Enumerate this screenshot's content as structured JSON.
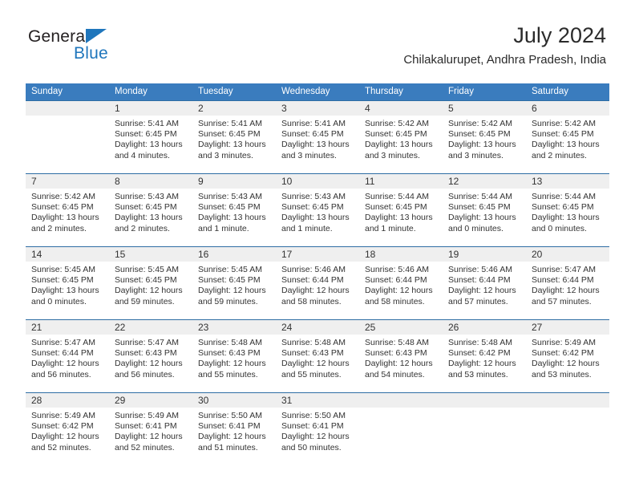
{
  "brand": {
    "name_part1": "General",
    "name_part2": "Blue",
    "triangle_color": "#1f76bc"
  },
  "header": {
    "title": "July 2024",
    "subtitle": "Chilakalurupet, Andhra Pradesh, India"
  },
  "colors": {
    "header_blue": "#3a7cbe",
    "week_divider": "#2e6da4",
    "daynum_band": "#efefef",
    "text": "#333333"
  },
  "weekdays": [
    "Sunday",
    "Monday",
    "Tuesday",
    "Wednesday",
    "Thursday",
    "Friday",
    "Saturday"
  ],
  "weeks": [
    {
      "days": [
        {
          "num": "",
          "sunrise": "",
          "sunset": "",
          "daylight1": "",
          "daylight2": ""
        },
        {
          "num": "1",
          "sunrise": "Sunrise: 5:41 AM",
          "sunset": "Sunset: 6:45 PM",
          "daylight1": "Daylight: 13 hours",
          "daylight2": "and 4 minutes."
        },
        {
          "num": "2",
          "sunrise": "Sunrise: 5:41 AM",
          "sunset": "Sunset: 6:45 PM",
          "daylight1": "Daylight: 13 hours",
          "daylight2": "and 3 minutes."
        },
        {
          "num": "3",
          "sunrise": "Sunrise: 5:41 AM",
          "sunset": "Sunset: 6:45 PM",
          "daylight1": "Daylight: 13 hours",
          "daylight2": "and 3 minutes."
        },
        {
          "num": "4",
          "sunrise": "Sunrise: 5:42 AM",
          "sunset": "Sunset: 6:45 PM",
          "daylight1": "Daylight: 13 hours",
          "daylight2": "and 3 minutes."
        },
        {
          "num": "5",
          "sunrise": "Sunrise: 5:42 AM",
          "sunset": "Sunset: 6:45 PM",
          "daylight1": "Daylight: 13 hours",
          "daylight2": "and 3 minutes."
        },
        {
          "num": "6",
          "sunrise": "Sunrise: 5:42 AM",
          "sunset": "Sunset: 6:45 PM",
          "daylight1": "Daylight: 13 hours",
          "daylight2": "and 2 minutes."
        }
      ]
    },
    {
      "days": [
        {
          "num": "7",
          "sunrise": "Sunrise: 5:42 AM",
          "sunset": "Sunset: 6:45 PM",
          "daylight1": "Daylight: 13 hours",
          "daylight2": "and 2 minutes."
        },
        {
          "num": "8",
          "sunrise": "Sunrise: 5:43 AM",
          "sunset": "Sunset: 6:45 PM",
          "daylight1": "Daylight: 13 hours",
          "daylight2": "and 2 minutes."
        },
        {
          "num": "9",
          "sunrise": "Sunrise: 5:43 AM",
          "sunset": "Sunset: 6:45 PM",
          "daylight1": "Daylight: 13 hours",
          "daylight2": "and 1 minute."
        },
        {
          "num": "10",
          "sunrise": "Sunrise: 5:43 AM",
          "sunset": "Sunset: 6:45 PM",
          "daylight1": "Daylight: 13 hours",
          "daylight2": "and 1 minute."
        },
        {
          "num": "11",
          "sunrise": "Sunrise: 5:44 AM",
          "sunset": "Sunset: 6:45 PM",
          "daylight1": "Daylight: 13 hours",
          "daylight2": "and 1 minute."
        },
        {
          "num": "12",
          "sunrise": "Sunrise: 5:44 AM",
          "sunset": "Sunset: 6:45 PM",
          "daylight1": "Daylight: 13 hours",
          "daylight2": "and 0 minutes."
        },
        {
          "num": "13",
          "sunrise": "Sunrise: 5:44 AM",
          "sunset": "Sunset: 6:45 PM",
          "daylight1": "Daylight: 13 hours",
          "daylight2": "and 0 minutes."
        }
      ]
    },
    {
      "days": [
        {
          "num": "14",
          "sunrise": "Sunrise: 5:45 AM",
          "sunset": "Sunset: 6:45 PM",
          "daylight1": "Daylight: 13 hours",
          "daylight2": "and 0 minutes."
        },
        {
          "num": "15",
          "sunrise": "Sunrise: 5:45 AM",
          "sunset": "Sunset: 6:45 PM",
          "daylight1": "Daylight: 12 hours",
          "daylight2": "and 59 minutes."
        },
        {
          "num": "16",
          "sunrise": "Sunrise: 5:45 AM",
          "sunset": "Sunset: 6:45 PM",
          "daylight1": "Daylight: 12 hours",
          "daylight2": "and 59 minutes."
        },
        {
          "num": "17",
          "sunrise": "Sunrise: 5:46 AM",
          "sunset": "Sunset: 6:44 PM",
          "daylight1": "Daylight: 12 hours",
          "daylight2": "and 58 minutes."
        },
        {
          "num": "18",
          "sunrise": "Sunrise: 5:46 AM",
          "sunset": "Sunset: 6:44 PM",
          "daylight1": "Daylight: 12 hours",
          "daylight2": "and 58 minutes."
        },
        {
          "num": "19",
          "sunrise": "Sunrise: 5:46 AM",
          "sunset": "Sunset: 6:44 PM",
          "daylight1": "Daylight: 12 hours",
          "daylight2": "and 57 minutes."
        },
        {
          "num": "20",
          "sunrise": "Sunrise: 5:47 AM",
          "sunset": "Sunset: 6:44 PM",
          "daylight1": "Daylight: 12 hours",
          "daylight2": "and 57 minutes."
        }
      ]
    },
    {
      "days": [
        {
          "num": "21",
          "sunrise": "Sunrise: 5:47 AM",
          "sunset": "Sunset: 6:44 PM",
          "daylight1": "Daylight: 12 hours",
          "daylight2": "and 56 minutes."
        },
        {
          "num": "22",
          "sunrise": "Sunrise: 5:47 AM",
          "sunset": "Sunset: 6:43 PM",
          "daylight1": "Daylight: 12 hours",
          "daylight2": "and 56 minutes."
        },
        {
          "num": "23",
          "sunrise": "Sunrise: 5:48 AM",
          "sunset": "Sunset: 6:43 PM",
          "daylight1": "Daylight: 12 hours",
          "daylight2": "and 55 minutes."
        },
        {
          "num": "24",
          "sunrise": "Sunrise: 5:48 AM",
          "sunset": "Sunset: 6:43 PM",
          "daylight1": "Daylight: 12 hours",
          "daylight2": "and 55 minutes."
        },
        {
          "num": "25",
          "sunrise": "Sunrise: 5:48 AM",
          "sunset": "Sunset: 6:43 PM",
          "daylight1": "Daylight: 12 hours",
          "daylight2": "and 54 minutes."
        },
        {
          "num": "26",
          "sunrise": "Sunrise: 5:48 AM",
          "sunset": "Sunset: 6:42 PM",
          "daylight1": "Daylight: 12 hours",
          "daylight2": "and 53 minutes."
        },
        {
          "num": "27",
          "sunrise": "Sunrise: 5:49 AM",
          "sunset": "Sunset: 6:42 PM",
          "daylight1": "Daylight: 12 hours",
          "daylight2": "and 53 minutes."
        }
      ]
    },
    {
      "days": [
        {
          "num": "28",
          "sunrise": "Sunrise: 5:49 AM",
          "sunset": "Sunset: 6:42 PM",
          "daylight1": "Daylight: 12 hours",
          "daylight2": "and 52 minutes."
        },
        {
          "num": "29",
          "sunrise": "Sunrise: 5:49 AM",
          "sunset": "Sunset: 6:41 PM",
          "daylight1": "Daylight: 12 hours",
          "daylight2": "and 52 minutes."
        },
        {
          "num": "30",
          "sunrise": "Sunrise: 5:50 AM",
          "sunset": "Sunset: 6:41 PM",
          "daylight1": "Daylight: 12 hours",
          "daylight2": "and 51 minutes."
        },
        {
          "num": "31",
          "sunrise": "Sunrise: 5:50 AM",
          "sunset": "Sunset: 6:41 PM",
          "daylight1": "Daylight: 12 hours",
          "daylight2": "and 50 minutes."
        },
        {
          "num": "",
          "sunrise": "",
          "sunset": "",
          "daylight1": "",
          "daylight2": ""
        },
        {
          "num": "",
          "sunrise": "",
          "sunset": "",
          "daylight1": "",
          "daylight2": ""
        },
        {
          "num": "",
          "sunrise": "",
          "sunset": "",
          "daylight1": "",
          "daylight2": ""
        }
      ]
    }
  ]
}
